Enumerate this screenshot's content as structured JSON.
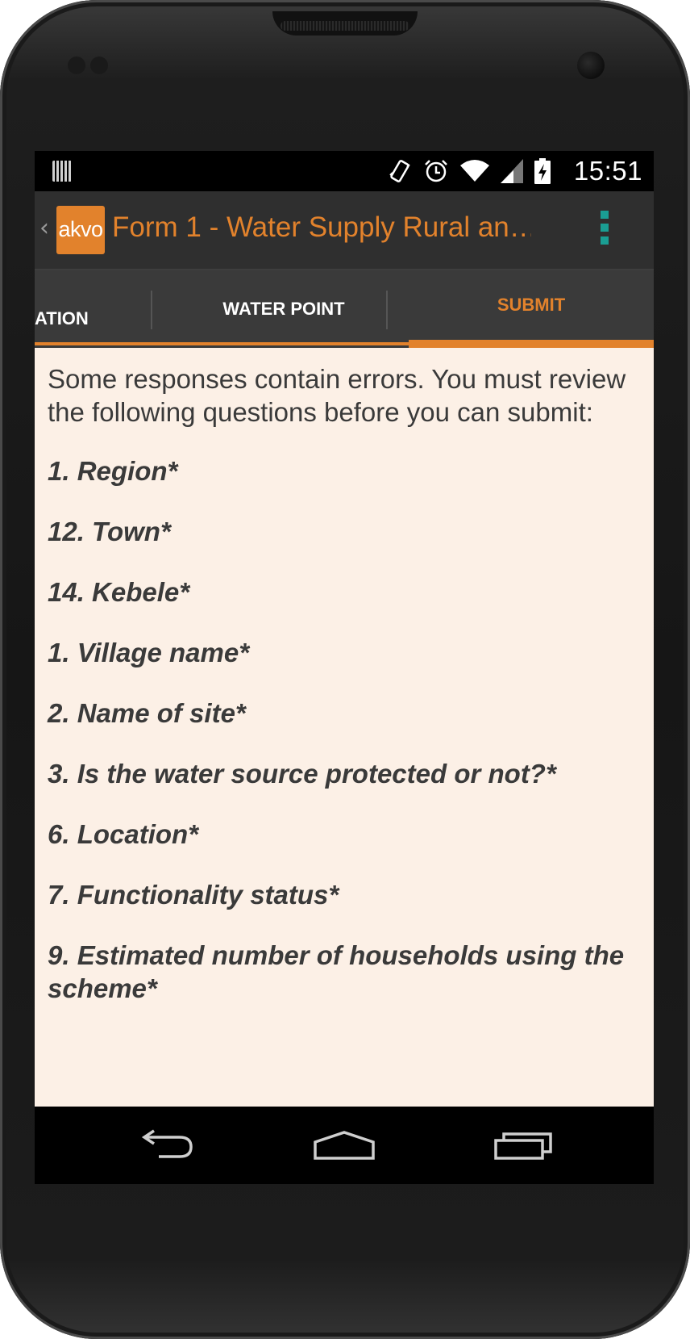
{
  "status_bar": {
    "time": "15:51"
  },
  "action_bar": {
    "logo_text": "akvo",
    "title": "Form 1 - Water Supply Rural an…",
    "accent_color": "#e2822c",
    "menu_color": "#1a9e93"
  },
  "tabs": [
    {
      "label": "ATION",
      "selected": false
    },
    {
      "label": "WATER POINT",
      "selected": false
    },
    {
      "label": "SUBMIT",
      "selected": true
    }
  ],
  "content": {
    "intro": "Some responses contain errors. You must review the following questions before you can submit:",
    "errors": [
      "1. Region*",
      "12. Town*",
      "14. Kebele*",
      "1. Village name*",
      "2. Name of site*",
      "3. Is the water source protected or not?*",
      "6. Location*",
      "7. Functionality status*",
      "9. Estimated number of households using the scheme*"
    ]
  },
  "icons": {
    "status": [
      "sim-card-icon",
      "vibrate-icon",
      "alarm-icon",
      "wifi-icon",
      "signal-icon",
      "battery-charging-icon"
    ],
    "nav": [
      "back-icon",
      "home-icon",
      "recent-apps-icon"
    ]
  }
}
